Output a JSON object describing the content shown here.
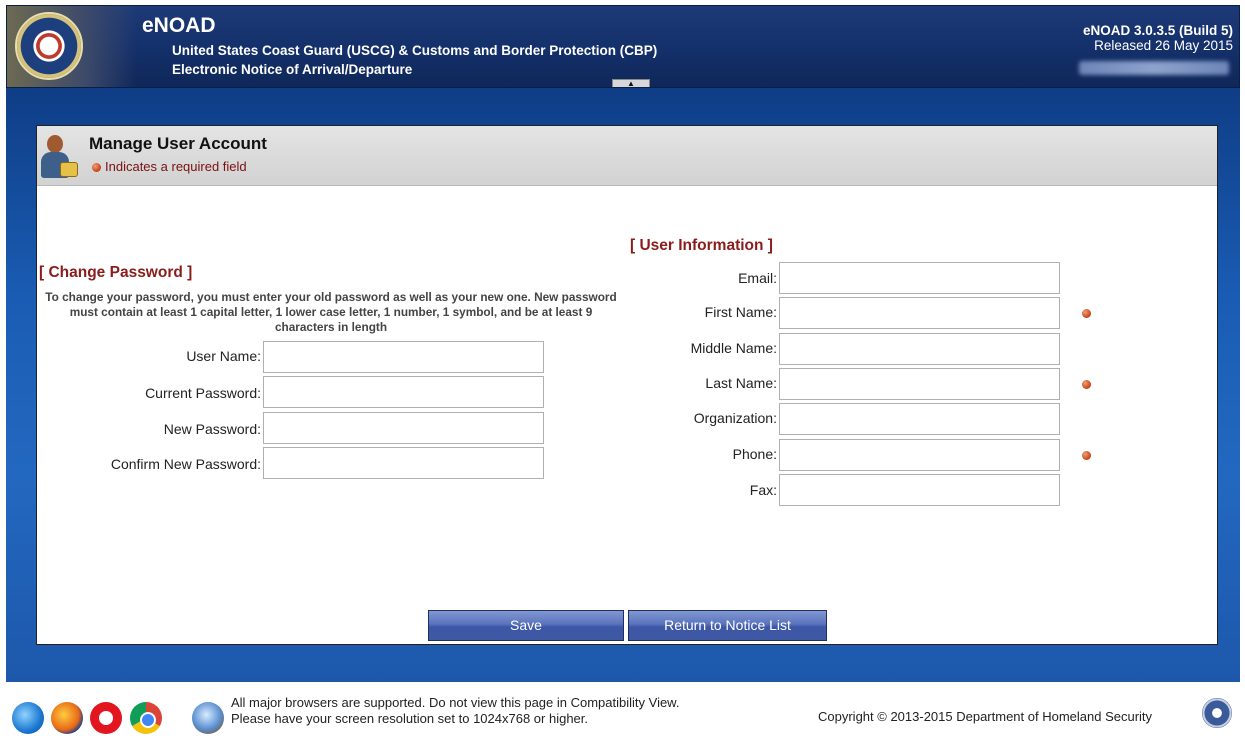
{
  "header": {
    "app_name": "eNOAD",
    "subtitle_line1": "United States Coast Guard (USCG) & Customs and Border Protection (CBP)",
    "subtitle_line2": "Electronic Notice of Arrival/Departure",
    "version": "eNOAD 3.0.3.5 (Build 5)",
    "release": "Released 26 May 2015",
    "collapse_glyph": "▲",
    "expand_glyph": "▼"
  },
  "panel": {
    "title": "Manage User Account",
    "required_note": "Indicates a required field"
  },
  "change_password": {
    "title": "[ Change Password ]",
    "note": "To change your password, you must enter your old password as well as your new one. New password must contain at least 1 capital letter, 1 lower case letter, 1 number, 1 symbol, and be at least 9 characters in length",
    "fields": {
      "user_name": {
        "label": "User Name:",
        "value": ""
      },
      "current_password": {
        "label": "Current Password:",
        "value": ""
      },
      "new_password": {
        "label": "New Password:",
        "value": ""
      },
      "confirm_new_password": {
        "label": "Confirm New Password:",
        "value": ""
      }
    }
  },
  "user_information": {
    "title": "[ User Information ]",
    "fields": {
      "email": {
        "label": "Email:",
        "value": "",
        "required": false
      },
      "first_name": {
        "label": "First Name:",
        "value": "",
        "required": true
      },
      "middle_name": {
        "label": "Middle Name:",
        "value": "",
        "required": false
      },
      "last_name": {
        "label": "Last Name:",
        "value": "",
        "required": true
      },
      "organization": {
        "label": "Organization:",
        "value": "",
        "required": false
      },
      "phone": {
        "label": "Phone:",
        "value": "",
        "required": true
      },
      "fax": {
        "label": "Fax:",
        "value": "",
        "required": false
      }
    }
  },
  "buttons": {
    "save": "Save",
    "return": "Return to Notice List"
  },
  "footer": {
    "browser_note_line1": "All major browsers are supported. Do not view this page in Compatibility View.",
    "browser_note_line2": "Please have your screen resolution set to 1024x768 or higher.",
    "copyright": "Copyright © 2013-2015 Department of Homeland Security",
    "browser_icons": [
      "internet-explorer-icon",
      "firefox-icon",
      "opera-icon",
      "chrome-icon",
      "safari-icon"
    ]
  },
  "colors": {
    "header_bg": "#14306a",
    "frame_blue": "#1a5cb3",
    "section_title": "#8b1c1c",
    "required_dot": "#c43f16",
    "button_blue": "#4a64b0"
  }
}
